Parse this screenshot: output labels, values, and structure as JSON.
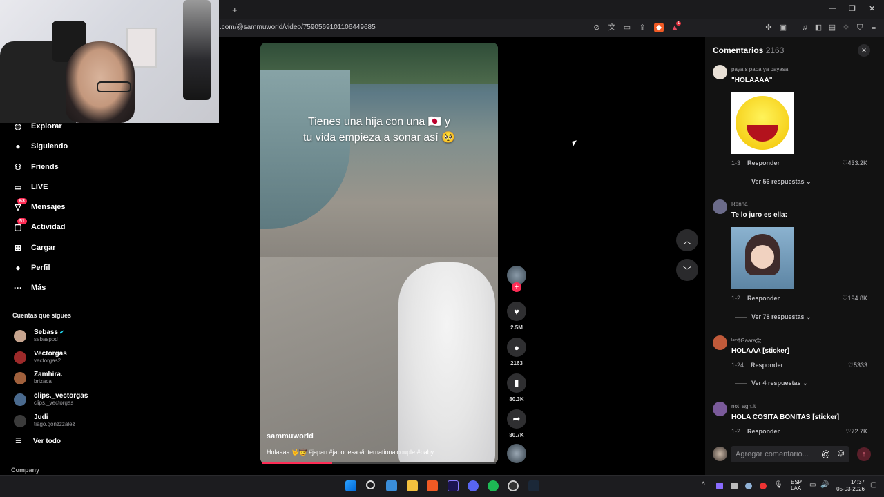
{
  "browser": {
    "url": ".com/@sammuworld/video/7590569101106449685",
    "new_tab_glyph": "+",
    "ext_badge": "1"
  },
  "sidebar": {
    "items": [
      {
        "label": "Explorar",
        "icon": "compass-icon",
        "glyph": "◎"
      },
      {
        "label": "Siguiendo",
        "icon": "following-icon",
        "glyph": "●"
      },
      {
        "label": "Friends",
        "icon": "friends-icon",
        "glyph": "⚇"
      },
      {
        "label": "LIVE",
        "icon": "live-icon",
        "glyph": "▭"
      },
      {
        "label": "Mensajes",
        "icon": "messages-icon",
        "glyph": "▽",
        "badge": "63"
      },
      {
        "label": "Actividad",
        "icon": "activity-icon",
        "glyph": "▢",
        "badge": "51"
      },
      {
        "label": "Cargar",
        "icon": "upload-icon",
        "glyph": "⊞"
      },
      {
        "label": "Perfil",
        "icon": "profile-icon",
        "glyph": "●"
      },
      {
        "label": "Más",
        "icon": "more-icon",
        "glyph": "···"
      }
    ],
    "following_title": "Cuentas que sigues",
    "following": [
      {
        "name": "Sebass",
        "handle": "sebaspod_",
        "verified": true
      },
      {
        "name": "Vectorgas",
        "handle": "vectorgas2"
      },
      {
        "name": "Zamhira.",
        "handle": "brizaca"
      },
      {
        "name": "clips._vectorgas",
        "handle": "clips._vectorgas"
      },
      {
        "name": "Judi",
        "handle": "tiago.gonzzzalez"
      }
    ],
    "see_all": "Ver todo",
    "company": "Company"
  },
  "video": {
    "caption_line1": "Tienes una hija con una 🇯🇵 y",
    "caption_line2": "tu vida empieza a sonar así 🥺",
    "author": "sammuworld",
    "description": "Holaaaa 🤟🤠 #japan #japonesa #internationalcouple #baby",
    "progress": 0.3
  },
  "actions": {
    "follow_plus": "+",
    "likes": "2.5M",
    "comments": "2163",
    "saves": "80.3K",
    "shares": "80.7K"
  },
  "comments_panel": {
    "title": "Comentarios",
    "count": "2163",
    "close_glyph": "✕",
    "items": [
      {
        "user": "paya s papa ya payasa",
        "text": "\"HOLAAAA\"",
        "date": "1-3",
        "reply": "Responder",
        "likes": "♡433.2K",
        "more": "Ver 56 respuestas ⌄"
      },
      {
        "user": "Renna",
        "text": "Te lo juro es ella:",
        "date": "1-2",
        "reply": "Responder",
        "likes": "♡194.8K",
        "more": "Ver 78 respuestas ⌄"
      },
      {
        "user": "ᴵᵃᵐ†Gaara爱",
        "text": "HOLAAA [sticker]",
        "date": "1-24",
        "reply": "Responder",
        "likes": "♡5333",
        "more": "Ver 4 respuestas ⌄"
      },
      {
        "user": "not_agn.it",
        "text": "HOLA COSITA BONITAS [sticker]",
        "date": "1-2",
        "reply": "Responder",
        "likes": "♡72.7K"
      }
    ],
    "add_placeholder": "Agregar comentario...",
    "at_glyph": "@",
    "emoji_glyph": "☺",
    "send_glyph": "↑"
  },
  "taskbar": {
    "lang": "ESP",
    "lang2": "LAA",
    "time": "14:37",
    "date": "05-03-2026",
    "chevron": "^"
  },
  "colors": {
    "accent": "#fe2c55",
    "panel": "#121212"
  }
}
